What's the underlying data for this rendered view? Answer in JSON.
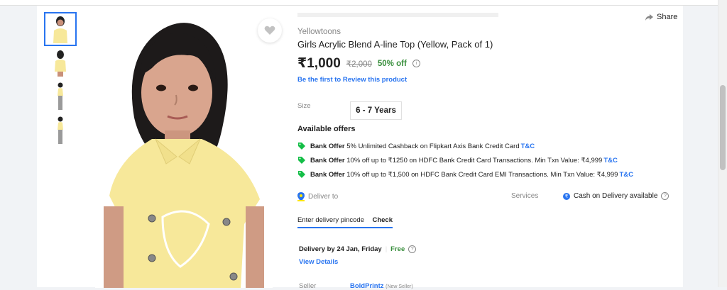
{
  "product": {
    "brand": "Yellowtoons",
    "title": "Girls Acrylic Blend A-line Top  (Yellow, Pack of 1)",
    "price": "₹1,000",
    "mrp": "₹2,000",
    "discount": "50% off",
    "review_link": "Be the first to Review this product",
    "share_label": "Share"
  },
  "size": {
    "label": "Size",
    "selected": "6 - 7 Years"
  },
  "offers": {
    "title": "Available offers",
    "items": [
      {
        "type": "Bank Offer",
        "text": "5% Unlimited Cashback on Flipkart Axis Bank Credit Card",
        "tc": "T&C"
      },
      {
        "type": "Bank Offer",
        "text": "10% off up to ₹1250 on HDFC Bank Credit Card Transactions. Min Txn Value: ₹4,999",
        "tc": "T&C"
      },
      {
        "type": "Bank Offer",
        "text": "10% off up to ₹1,500 on HDFC Bank Credit Card EMI Transactions. Min Txn Value: ₹4,999",
        "tc": "T&C"
      }
    ]
  },
  "delivery": {
    "deliver_to": "Deliver to",
    "pincode_placeholder": "Enter delivery pincode",
    "check": "Check",
    "date": "Delivery by 24 Jan, Friday",
    "separator": "|",
    "free": "Free",
    "view_details": "View Details"
  },
  "services": {
    "label": "Services",
    "cod": "Cash on Delivery available"
  },
  "seller": {
    "label": "Seller",
    "name": "BoldPrintz",
    "tag": "(New Seller)"
  },
  "colors": {
    "accent": "#2874f0",
    "green": "#388e3c",
    "shirt": "#f7e89a"
  },
  "icons": {
    "wishlist": "heart-icon",
    "share": "share-icon",
    "offer": "tag-icon",
    "location": "location-pin-icon"
  }
}
